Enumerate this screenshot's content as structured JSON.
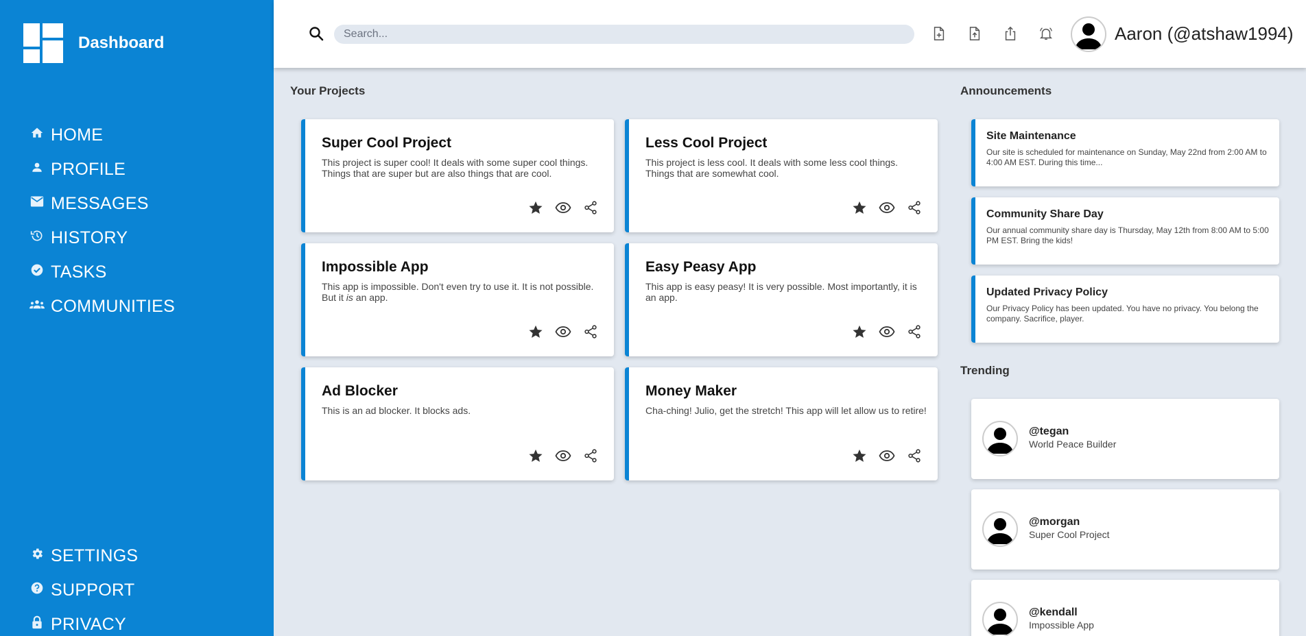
{
  "brand": {
    "title": "Dashboard"
  },
  "sidebar": {
    "items": [
      {
        "label": "HOME",
        "icon": "home-icon"
      },
      {
        "label": "PROFILE",
        "icon": "person-icon"
      },
      {
        "label": "MESSAGES",
        "icon": "mail-icon"
      },
      {
        "label": "HISTORY",
        "icon": "history-icon"
      },
      {
        "label": "TASKS",
        "icon": "check-circle-icon"
      },
      {
        "label": "COMMUNITIES",
        "icon": "group-icon"
      }
    ],
    "bottom_items": [
      {
        "label": "SETTINGS",
        "icon": "gear-icon"
      },
      {
        "label": "SUPPORT",
        "icon": "help-icon"
      },
      {
        "label": "PRIVACY",
        "icon": "lock-icon"
      }
    ]
  },
  "header": {
    "search": {
      "placeholder": "Search..."
    },
    "user": {
      "display": "Aaron  (@atshaw1994)"
    },
    "icons": [
      "new-file-icon",
      "upload-icon",
      "share-icon",
      "bell-icon"
    ]
  },
  "projects": {
    "title": "Your Projects",
    "items": [
      {
        "title": "Super Cool Project",
        "desc": "This project is super cool! It deals with some super cool things. Things that are super but are also things that are cool."
      },
      {
        "title": "Less Cool Project",
        "desc": "This project is less cool. It deals with some less cool things. Things that are somewhat cool."
      },
      {
        "title": "Impossible App",
        "desc_parts": [
          "This app is impossible. Don't even try to use it. It is not possible. But it ",
          "is",
          " an app."
        ]
      },
      {
        "title": "Easy Peasy App",
        "desc": "This app is easy peasy! It is very possible. Most importantly, it is an app."
      },
      {
        "title": "Ad Blocker",
        "desc": "This is an ad blocker. It blocks ads."
      },
      {
        "title": "Money Maker",
        "desc": "Cha-ching! Julio, get the stretch! This app will let allow us to retire!"
      }
    ]
  },
  "announcements": {
    "title": "Announcements",
    "items": [
      {
        "title": "Site Maintenance",
        "desc": "Our site is scheduled for maintenance on Sunday, May 22nd from 2:00 AM to 4:00 AM EST. During this time..."
      },
      {
        "title": "Community Share Day",
        "desc": "Our annual community share day is Thursday, May 12th from 8:00 AM to 5:00 PM EST. Bring the kids!"
      },
      {
        "title": "Updated Privacy Policy",
        "desc": "Our Privacy Policy has been updated. You have no privacy. You belong the company. Sacrifice, player."
      }
    ]
  },
  "trending": {
    "title": "Trending",
    "items": [
      {
        "handle": "@tegan",
        "sub": "World Peace Builder"
      },
      {
        "handle": "@morgan",
        "sub": "Super Cool Project"
      },
      {
        "handle": "@kendall",
        "sub": "Impossible App"
      }
    ]
  },
  "colors": {
    "accent": "#0b84d4",
    "background": "#e2e8f0"
  }
}
